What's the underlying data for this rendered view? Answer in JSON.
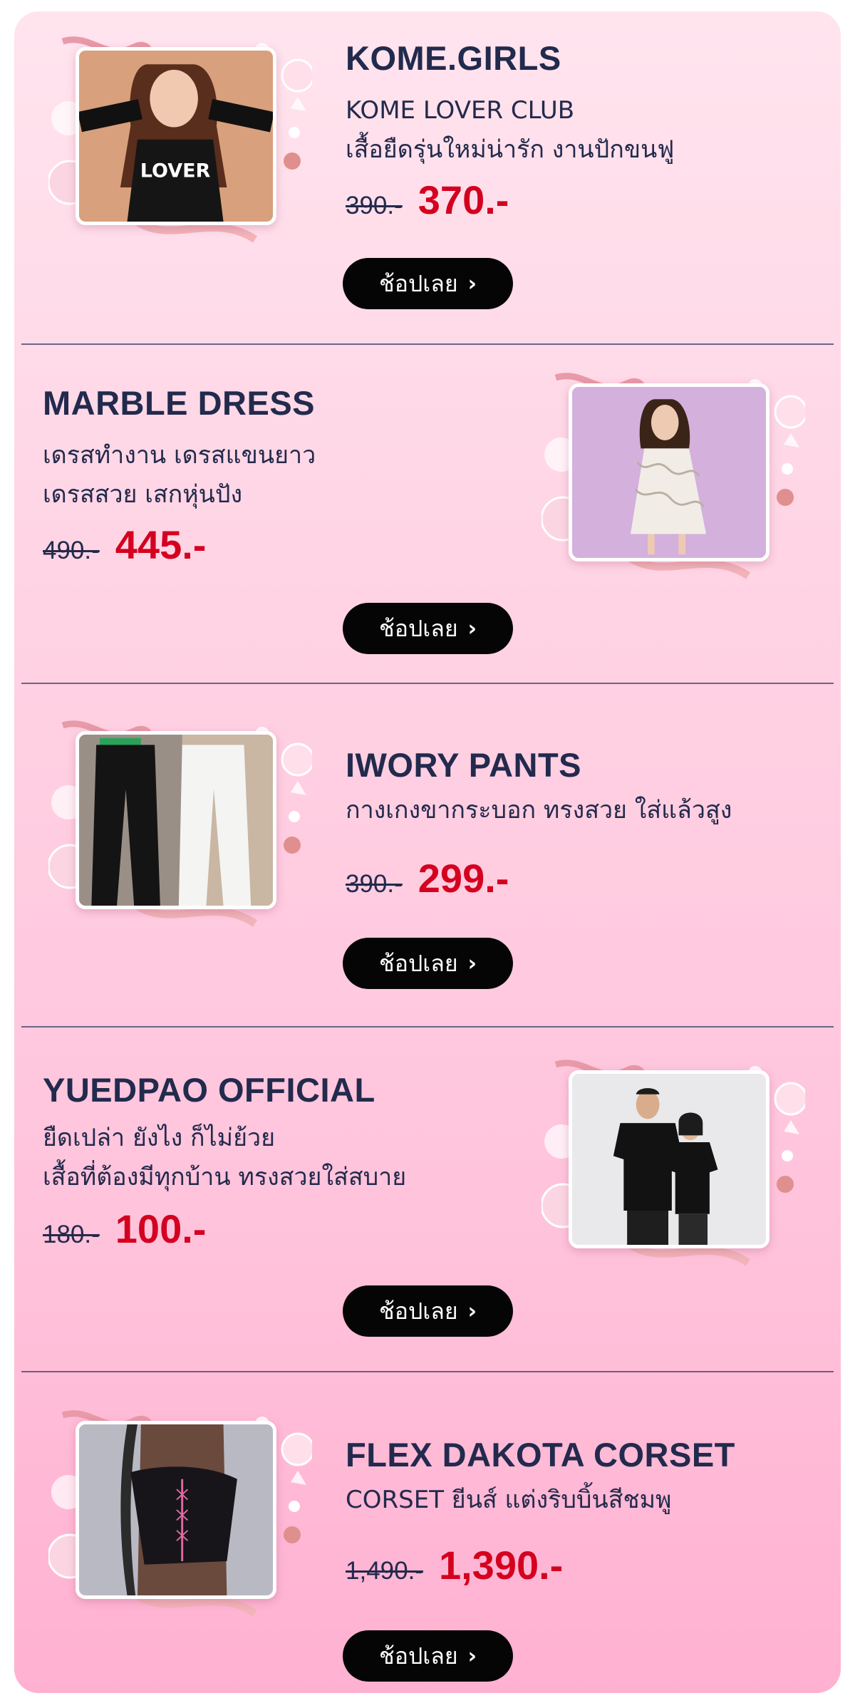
{
  "shop_button_label": "ช้อปเลย",
  "products": [
    {
      "title": "KOME.GIRLS",
      "desc_line1": "KOME LOVER CLUB",
      "desc_line2": "เสื้อยืดรุ่นใหม่น่ารัก งานปักขนฟู",
      "old_price": "390.-",
      "new_price": "370.-",
      "image": "woman-in-black-lover-tshirt",
      "image_side": "left"
    },
    {
      "title": "MARBLE DRESS",
      "desc_line1": "เดรสทำงาน เดรสแขนยาว",
      "desc_line2": "เดรสสวย เสกหุ่นปัง",
      "old_price": "490.-",
      "new_price": "445.-",
      "image": "woman-in-marble-dress",
      "image_side": "right"
    },
    {
      "title": "IWORY PANTS",
      "desc_line1": "กางเกงขากระบอก ทรงสวย ใส่แล้วสูง",
      "desc_line2": "",
      "old_price": "390.-",
      "new_price": "299.-",
      "image": "black-and-white-pants",
      "image_side": "left"
    },
    {
      "title": "YUEDPAO OFFICIAL",
      "desc_line1": "ยืดเปล่า ยังไง ก็ไม่ย้วย",
      "desc_line2": "เสื้อที่ต้องมีทุกบ้าน ทรงสวยใส่สบาย",
      "old_price": "180.-",
      "new_price": "100.-",
      "image": "couple-in-black-tshirts",
      "image_side": "right"
    },
    {
      "title": "FLEX  DAKOTA CORSET",
      "desc_line1": "CORSET ยีนส์ แต่งริบบิ้นสีชมพู",
      "desc_line2": "",
      "old_price": "1,490.-",
      "new_price": "1,390.-",
      "image": "black-denim-corset",
      "image_side": "left"
    }
  ],
  "colors": {
    "title": "#222a4d",
    "price_new": "#d4001f",
    "button_bg": "#050505",
    "panel_top": "#ffe4ee",
    "panel_bottom": "#ffb1d1"
  }
}
